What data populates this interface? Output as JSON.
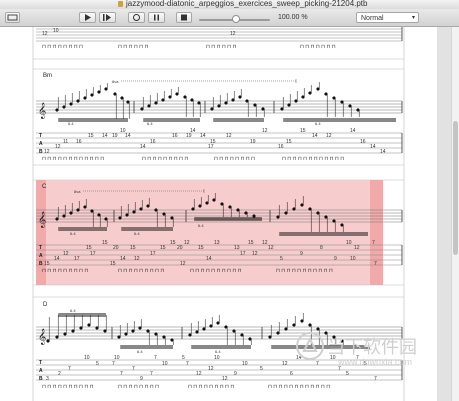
{
  "window": {
    "title": "jazzymood-diatonic_arpeggios_exercices_sweep_picking-21204.ptb"
  },
  "toolbar": {
    "zoom": "100.00 %",
    "view_mode": "Normal"
  },
  "sections": [
    {
      "chord": "Bm",
      "highlighted": false
    },
    {
      "chord": "C",
      "highlighted": true
    },
    {
      "chord": "D",
      "highlighted": false
    }
  ],
  "top_tab": {
    "notes": [
      "10",
      "12",
      "12"
    ]
  },
  "bm_tab": {
    "marks": [
      "6.4",
      "6.4",
      "6.4"
    ],
    "e": [
      "10",
      "14",
      "12",
      "15",
      "14"
    ],
    "b": [
      "15",
      "14",
      "19",
      "14",
      "16",
      "19",
      "14",
      "12",
      "14",
      "12"
    ],
    "g": [
      "11",
      "16",
      "16",
      "15",
      "19",
      "15",
      "16"
    ],
    "d": [
      "12",
      "14",
      "17",
      "16",
      "14"
    ],
    "a": [
      "12",
      "14"
    ]
  },
  "c_tab": {
    "marks": [
      "6.4",
      "6.4",
      "6.4"
    ],
    "e": [
      "15",
      "15",
      "12",
      "13",
      "15",
      "12",
      "10",
      "7"
    ],
    "b": [
      "15",
      "20",
      "15",
      "15",
      "20",
      "15",
      "13",
      "12",
      "8",
      "12"
    ],
    "g": [
      "12",
      "17",
      "17",
      "17",
      "12",
      "9"
    ],
    "d": [
      "14",
      "17",
      "14",
      "12",
      "14",
      "5",
      "9",
      "10"
    ],
    "a": [
      "15",
      "15",
      "12",
      "7"
    ]
  },
  "d_tab": {
    "marks": [
      "6.4",
      "6.4",
      "6.4"
    ],
    "e": [
      "10",
      "10",
      "7",
      "5",
      "10",
      "14",
      "10",
      "7"
    ],
    "b": [
      "5",
      "7",
      "10",
      "7",
      "10",
      "12",
      "7",
      "5"
    ],
    "g": [
      "7",
      "7",
      "12",
      "5",
      "7"
    ],
    "d": [
      "2",
      "7",
      "7",
      "12",
      "9",
      "6",
      "5"
    ],
    "a": [
      "3",
      "9",
      "12",
      "7"
    ]
  },
  "watermark": {
    "text": "当下软件园",
    "url": "www.downxia.com"
  },
  "colors": {
    "highlight": "#f6cccc",
    "highlight_edge": "#ef9a9a",
    "watermark": "#cfcfcf"
  }
}
